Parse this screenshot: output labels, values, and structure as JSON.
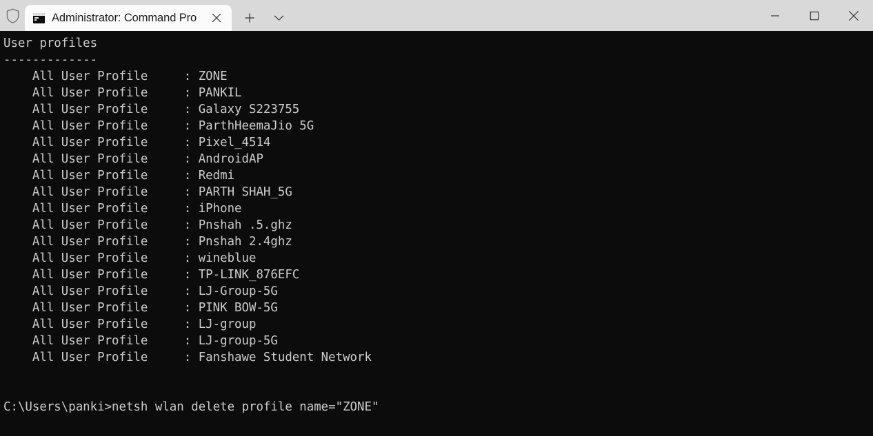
{
  "window": {
    "admin_shield_icon": "shield-icon",
    "tab": {
      "favicon": "console-icon",
      "title": "Administrator: Command Pro",
      "close_icon": "close-icon"
    },
    "new_tab_icon": "plus-icon",
    "tab_menu_icon": "chevron-down-icon",
    "controls": {
      "minimize_icon": "minimize-icon",
      "maximize_icon": "maximize-icon",
      "close_icon": "close-icon"
    },
    "colors": {
      "titlebar_bg": "#d9d9d9",
      "tab_bg": "#fbfbfb",
      "terminal_bg": "#0c0c0c",
      "terminal_fg": "#cccccc"
    }
  },
  "terminal": {
    "heading": "User profiles",
    "heading_rule": "-------------",
    "profile_label": "All User Profile",
    "profiles": [
      "ZONE",
      "PANKIL",
      "Galaxy S223755",
      "ParthHeemaJio 5G",
      "Pixel_4514",
      "AndroidAP",
      "Redmi",
      "PARTH SHAH_5G",
      "iPhone",
      "Pnshah .5.ghz",
      "Pnshah 2.4ghz",
      "wineblue",
      "TP-LINK_876EFC",
      "LJ-Group-5G",
      "PINK BOW-5G",
      "LJ-group",
      "LJ-group-5G",
      "Fanshawe Student Network"
    ],
    "prompt": "C:\\Users\\panki>",
    "command": "netsh wlan delete profile name=\"ZONE\"",
    "screen_text": "User profiles\n-------------\n    All User Profile     : ZONE\n    All User Profile     : PANKIL\n    All User Profile     : Galaxy S223755\n    All User Profile     : ParthHeemaJio 5G\n    All User Profile     : Pixel_4514\n    All User Profile     : AndroidAP\n    All User Profile     : Redmi\n    All User Profile     : PARTH SHAH_5G\n    All User Profile     : iPhone\n    All User Profile     : Pnshah .5.ghz\n    All User Profile     : Pnshah 2.4ghz\n    All User Profile     : wineblue\n    All User Profile     : TP-LINK_876EFC\n    All User Profile     : LJ-Group-5G\n    All User Profile     : PINK BOW-5G\n    All User Profile     : LJ-group\n    All User Profile     : LJ-group-5G\n    All User Profile     : Fanshawe Student Network\n\n\nC:\\Users\\panki>netsh wlan delete profile name=\"ZONE\""
  }
}
